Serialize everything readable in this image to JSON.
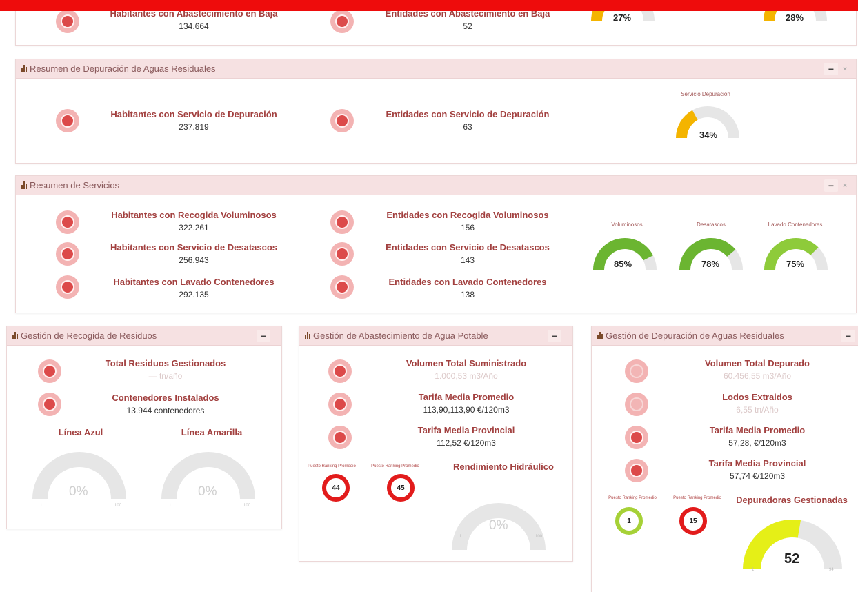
{
  "colors": {
    "accent_red": "#ee0c0c",
    "panel_header": "#f6e1e2",
    "title_text": "#a2403f",
    "gauge_orange": "#f4b400",
    "gauge_green": "#6bb531",
    "gauge_light_green": "#8ecb3a",
    "gauge_yellow": "#e5ef17",
    "gauge_grey": "#e6e6e6",
    "ring_red": "#e21b1b",
    "ring_green": "#a6d137"
  },
  "abastecimiento_top": {
    "hab_baja_title": "Habitantes con Abastecimiento en Baja",
    "hab_baja_value": "134.664",
    "ent_baja_title": "Entidades con Abastecimiento en Baja",
    "ent_baja_value": "52",
    "gauge1_pct": "27%",
    "gauge1_value": 27,
    "gauge2_pct": "28%",
    "gauge2_value": 28
  },
  "depuracion": {
    "header": "Resumen de Depuración de Aguas Residuales",
    "hab_title": "Habitantes con Servicio de Depuración",
    "hab_value": "237.819",
    "ent_title": "Entidades con Servicio de Depuración",
    "ent_value": "63",
    "gauge_title": "Servicio Depuración",
    "gauge_pct": "34%",
    "gauge_value": 34
  },
  "servicios": {
    "header": "Resumen de Servicios",
    "rows": [
      {
        "hab_title": "Habitantes con Recogida Voluminosos",
        "hab_value": "322.261",
        "ent_title": "Entidades con Recogida Voluminosos",
        "ent_value": "156"
      },
      {
        "hab_title": "Habitantes con Servicio de Desatascos",
        "hab_value": "256.943",
        "ent_title": "Entidades con Servicio de Desatascos",
        "ent_value": "143"
      },
      {
        "hab_title": "Habitantes con Lavado Contenedores",
        "hab_value": "292.135",
        "ent_title": "Entidades con Lavado Contenedores",
        "ent_value": "138"
      }
    ],
    "gauges": [
      {
        "title": "Voluminosos",
        "pct": "85%",
        "value": 85
      },
      {
        "title": "Desatascos",
        "pct": "78%",
        "value": 78
      },
      {
        "title": "Lavado Contenedores",
        "pct": "75%",
        "value": 75
      }
    ]
  },
  "recogida": {
    "header": "Gestión de Recogida de Residuos",
    "total_title": "Total Residuos Gestionados",
    "total_value": "— tn/año",
    "cont_title": "Contenedores Instalados",
    "cont_value": "13.944 contenedores",
    "azul_title": "Línea Azul",
    "azul_pct": "0%",
    "amarilla_title": "Línea Amarilla",
    "amarilla_pct": "0%",
    "gauge_min": "1",
    "gauge_max": "100"
  },
  "abastecimiento": {
    "header": "Gestión de Abastecimiento de Agua Potable",
    "vol_title": "Volumen Total Suministrado",
    "vol_value": "1.000,53 m3/Año",
    "tarifa_title": "Tarifa Media Promedio",
    "tarifa_value": "113,90,113,90 €/120m3",
    "prov_title": "Tarifa Media Provincial",
    "prov_value": "112,52 €/120m3",
    "rank_label": "Puesto Ranking Promedio",
    "rank1": "44",
    "rank2": "45",
    "rend_title": "Rendimiento Hidráulico",
    "rend_pct": "0%",
    "gauge_min": "1",
    "gauge_max": "100"
  },
  "depuracion_gestion": {
    "header": "Gestión de Depuración de Aguas Residuales",
    "vol_title": "Volumen Total Depurado",
    "vol_value": "60.456,55 m3/Año",
    "lodos_title": "Lodos Extraidos",
    "lodos_value": "6,55 tn/Año",
    "tarifa_title": "Tarifa Media Promedio",
    "tarifa_value": "57,28, €/120m3",
    "prov_title": "Tarifa Media Provincial",
    "prov_value": "57,74 €/120m3",
    "rank_label": "Puesto Ranking Promedio",
    "rank1": "1",
    "rank2": "15",
    "dep_title": "Depuradoras Gestionadas",
    "dep_value": "52",
    "dep_number": 52,
    "gauge_min": "1",
    "gauge_max": "94"
  },
  "icons": {
    "stat_icon": "water-drop-icon",
    "chart_icon": "bar-chart-icon",
    "collapse": "minus-icon",
    "close": "close-icon"
  },
  "ui": {
    "minus": "−",
    "close": "×"
  }
}
